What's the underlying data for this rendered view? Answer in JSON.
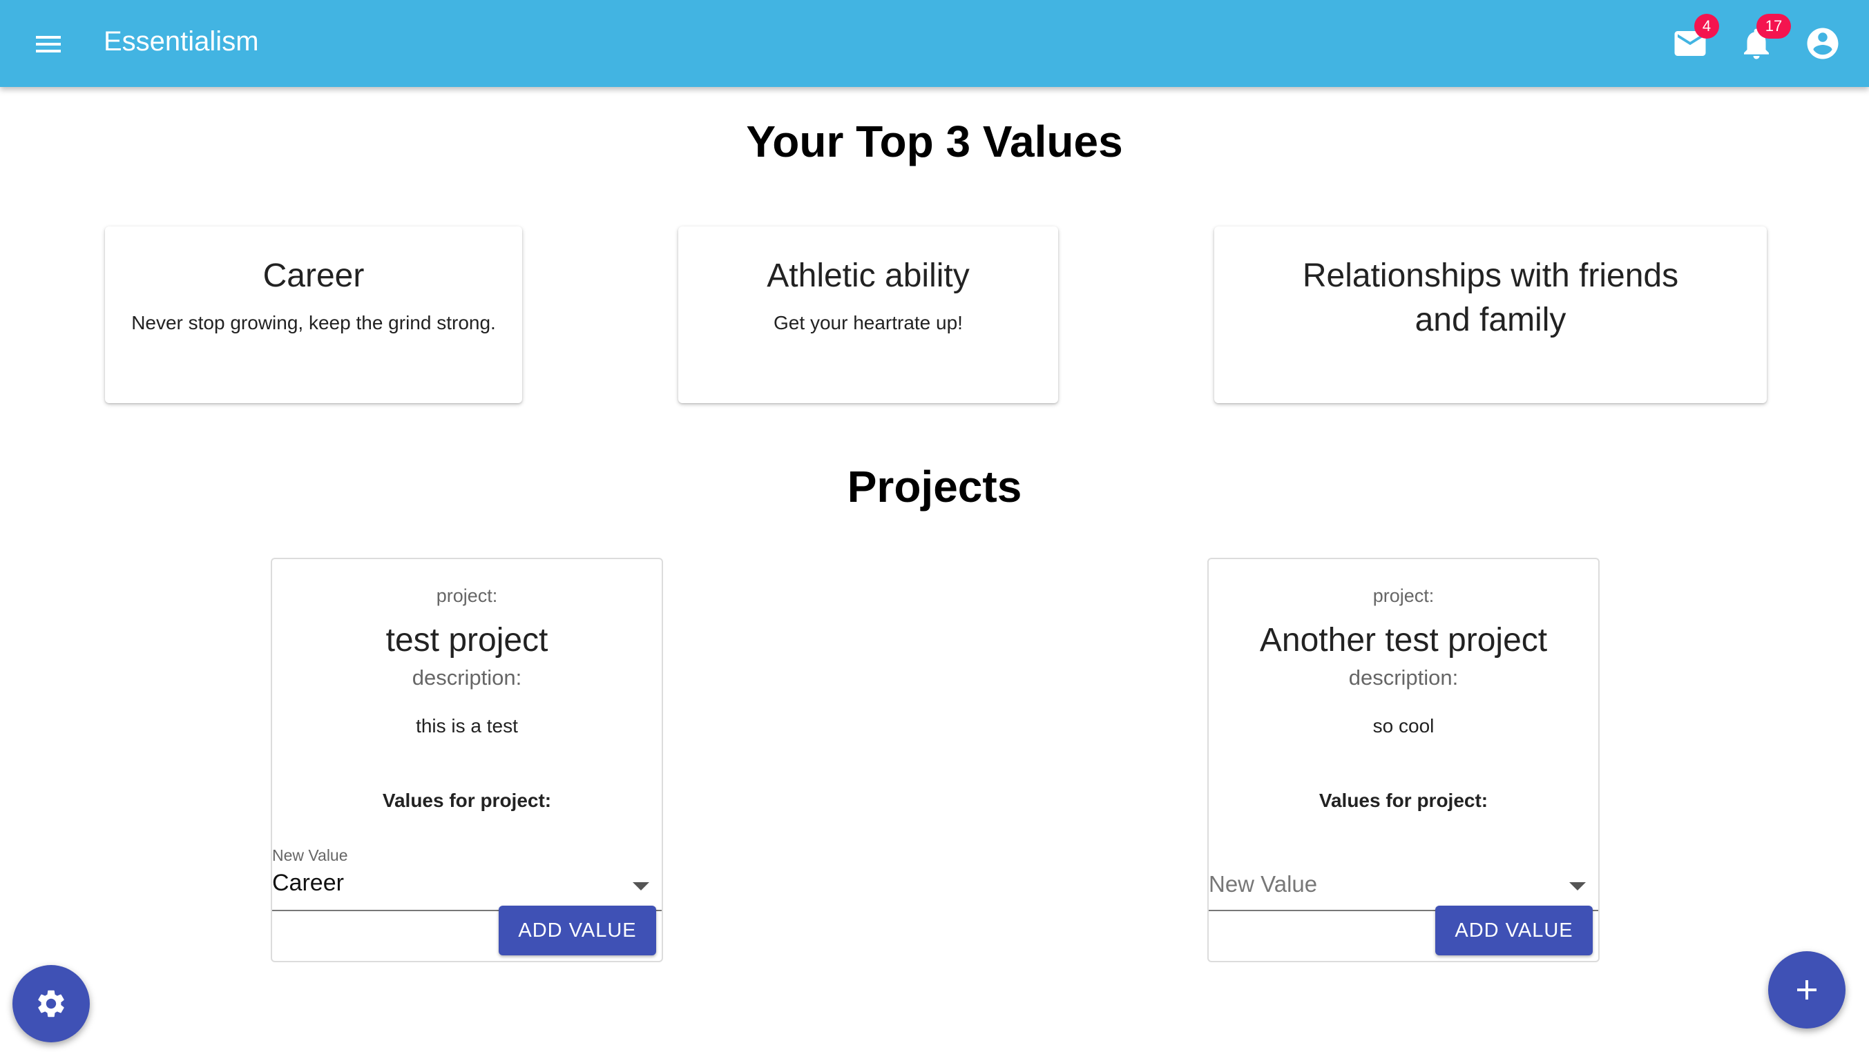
{
  "colors": {
    "appbar": "#42b4e2",
    "primary": "#3f51b5",
    "badge": "#f4144f"
  },
  "header": {
    "title": "Essentialism",
    "menu_icon": "menu-icon",
    "mail": {
      "icon": "mail-icon",
      "badge": "4"
    },
    "notifications": {
      "icon": "bell-icon",
      "badge": "17"
    },
    "account_icon": "account-circle-icon"
  },
  "values_section": {
    "title": "Your Top 3 Values",
    "cards": [
      {
        "title": "Career",
        "description": "Never stop growing, keep the grind strong."
      },
      {
        "title": "Athletic ability",
        "description": "Get your heartrate up!"
      },
      {
        "title": "Relationships with friends and family",
        "description": ""
      }
    ]
  },
  "projects_section": {
    "title": "Projects",
    "projects": [
      {
        "project_label": "project:",
        "name": "test project",
        "description_label": "description:",
        "description": "this is a test",
        "values_label": "Values for project:",
        "select_label": "New Value",
        "select_value": "Career",
        "button": "ADD VALUE"
      },
      {
        "project_label": "project:",
        "name": "Another test project",
        "description_label": "description:",
        "description": "so cool",
        "values_label": "Values for project:",
        "select_placeholder": "New Value",
        "button": "ADD VALUE"
      }
    ]
  },
  "fabs": {
    "settings_icon": "gear-icon",
    "add_icon": "plus-icon"
  }
}
